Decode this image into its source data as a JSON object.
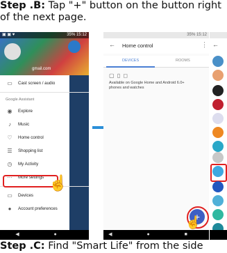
{
  "step_b": {
    "label": "Step .B:",
    "text": " Tap \"+\" button on the button right of the next page."
  },
  "step_c": {
    "label": "Step .C:",
    "text": " Find \"Smart Life\" from the side"
  },
  "phone1": {
    "status_right": "35% 15:12",
    "account_name": "gmail.com",
    "menu": [
      {
        "label": "Cast screen / audio",
        "icon": "cast-icon",
        "glyph": "▭"
      },
      {
        "section": "Google Assistant"
      },
      {
        "label": "Explore",
        "icon": "compass-icon",
        "glyph": "◉"
      },
      {
        "label": "Music",
        "icon": "music-icon",
        "glyph": "♪"
      },
      {
        "label": "Home control",
        "icon": "lightbulb-icon",
        "glyph": "♡"
      },
      {
        "label": "Shopping list",
        "icon": "list-icon",
        "glyph": "☰"
      },
      {
        "label": "My Activity",
        "icon": "history-icon",
        "glyph": "◷"
      },
      {
        "label": "More settings",
        "icon": "more-icon",
        "glyph": "···"
      },
      {
        "label": "Devices",
        "icon": "devices-icon",
        "glyph": "▭"
      },
      {
        "label": "Account preferences",
        "icon": "account-icon",
        "glyph": "●"
      }
    ],
    "nav": "◀ ● ■"
  },
  "phone2": {
    "status_right": "35% 15:12",
    "title": "Home control",
    "tabs": [
      "DEVICES",
      "ROOMS"
    ],
    "device_icons": "▢ ▯ ◻",
    "available": "Available on Google Home and Android 6.0+ phones and watches",
    "fab": "+",
    "nav": "◀ ● ■"
  },
  "phone3": {
    "back": "←"
  },
  "colors": {
    "highlight": "#e02020",
    "fab": "#3d5fc4",
    "arrow": "#2b8fd8",
    "tab_active": "#4a7fd4"
  }
}
